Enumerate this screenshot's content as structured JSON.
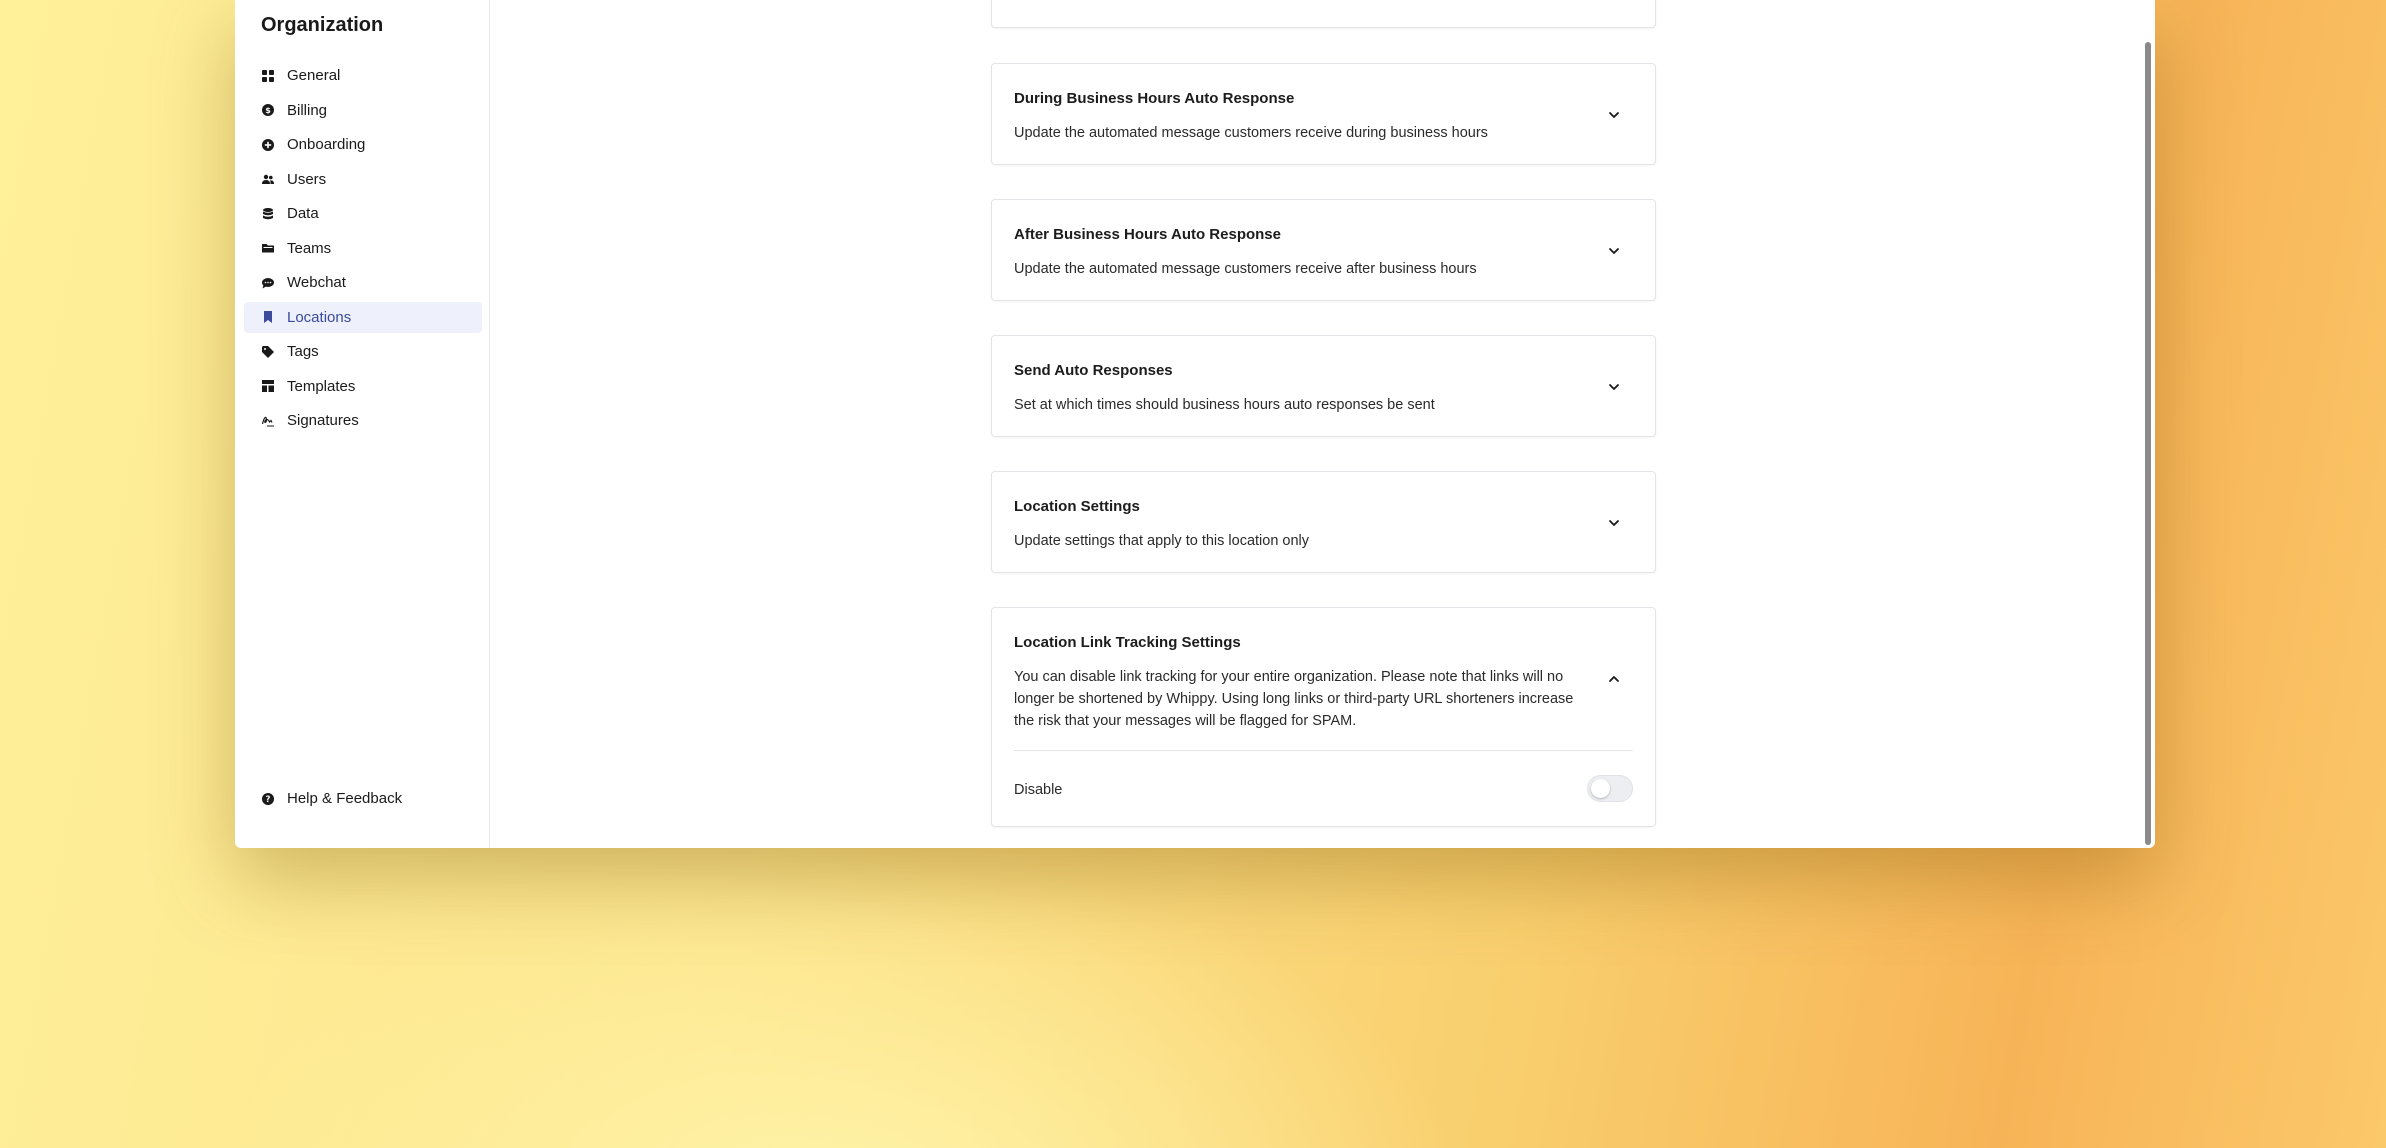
{
  "sidebar": {
    "title": "Organization",
    "items": [
      {
        "label": "General",
        "icon": "grid-icon"
      },
      {
        "label": "Billing",
        "icon": "dollar-icon"
      },
      {
        "label": "Onboarding",
        "icon": "plus-circle-icon"
      },
      {
        "label": "Users",
        "icon": "users-icon"
      },
      {
        "label": "Data",
        "icon": "database-icon"
      },
      {
        "label": "Teams",
        "icon": "folder-icon"
      },
      {
        "label": "Webchat",
        "icon": "chat-icon"
      },
      {
        "label": "Locations",
        "icon": "bookmark-icon",
        "active": true
      },
      {
        "label": "Tags",
        "icon": "tag-icon"
      },
      {
        "label": "Templates",
        "icon": "template-icon"
      },
      {
        "label": "Signatures",
        "icon": "signature-icon"
      }
    ],
    "help_label": "Help & Feedback"
  },
  "cards": [
    {
      "title": "During Business Hours Auto Response",
      "description": "Update the automated message customers receive during business hours",
      "expanded": false
    },
    {
      "title": "After Business Hours Auto Response",
      "description": "Update the automated message customers receive after business hours",
      "expanded": false
    },
    {
      "title": "Send Auto Responses",
      "description": "Set at which times should business hours auto responses be sent",
      "expanded": false
    },
    {
      "title": "Location Settings",
      "description": "Update settings that apply to this location only",
      "expanded": false
    },
    {
      "title": "Location Link Tracking Settings",
      "description": "You can disable link tracking for your entire organization. Please note that links will no longer be shortened by Whippy. Using long links or third-party URL shorteners increase the risk that your messages will be flagged for SPAM.",
      "expanded": true,
      "toggle_label": "Disable",
      "toggle_on": false
    }
  ],
  "colors": {
    "accent": "#3b4b9b",
    "active_bg": "#eef0fb"
  }
}
